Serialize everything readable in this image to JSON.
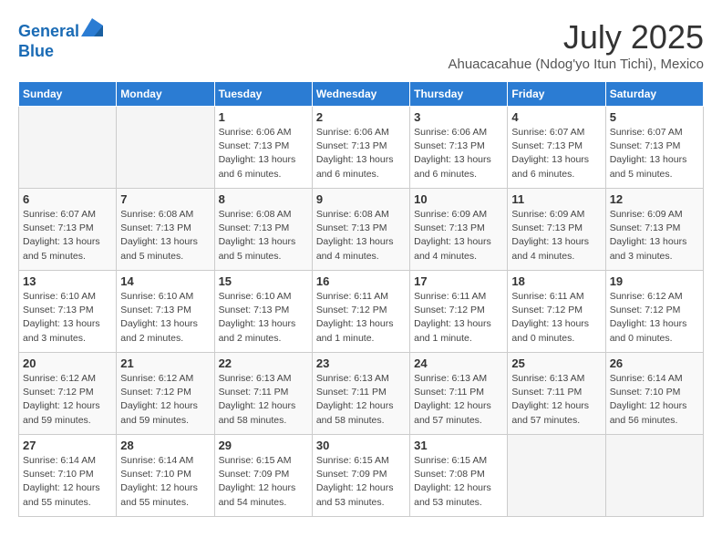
{
  "header": {
    "logo_line1": "General",
    "logo_line2": "Blue",
    "month": "July 2025",
    "location": "Ahuacacahue (Ndog'yo Itun Tichi), Mexico"
  },
  "weekdays": [
    "Sunday",
    "Monday",
    "Tuesday",
    "Wednesday",
    "Thursday",
    "Friday",
    "Saturday"
  ],
  "weeks": [
    [
      {
        "day": "",
        "empty": true
      },
      {
        "day": "",
        "empty": true
      },
      {
        "day": "1",
        "sunrise": "Sunrise: 6:06 AM",
        "sunset": "Sunset: 7:13 PM",
        "daylight": "Daylight: 13 hours and 6 minutes."
      },
      {
        "day": "2",
        "sunrise": "Sunrise: 6:06 AM",
        "sunset": "Sunset: 7:13 PM",
        "daylight": "Daylight: 13 hours and 6 minutes."
      },
      {
        "day": "3",
        "sunrise": "Sunrise: 6:06 AM",
        "sunset": "Sunset: 7:13 PM",
        "daylight": "Daylight: 13 hours and 6 minutes."
      },
      {
        "day": "4",
        "sunrise": "Sunrise: 6:07 AM",
        "sunset": "Sunset: 7:13 PM",
        "daylight": "Daylight: 13 hours and 6 minutes."
      },
      {
        "day": "5",
        "sunrise": "Sunrise: 6:07 AM",
        "sunset": "Sunset: 7:13 PM",
        "daylight": "Daylight: 13 hours and 5 minutes."
      }
    ],
    [
      {
        "day": "6",
        "sunrise": "Sunrise: 6:07 AM",
        "sunset": "Sunset: 7:13 PM",
        "daylight": "Daylight: 13 hours and 5 minutes."
      },
      {
        "day": "7",
        "sunrise": "Sunrise: 6:08 AM",
        "sunset": "Sunset: 7:13 PM",
        "daylight": "Daylight: 13 hours and 5 minutes."
      },
      {
        "day": "8",
        "sunrise": "Sunrise: 6:08 AM",
        "sunset": "Sunset: 7:13 PM",
        "daylight": "Daylight: 13 hours and 5 minutes."
      },
      {
        "day": "9",
        "sunrise": "Sunrise: 6:08 AM",
        "sunset": "Sunset: 7:13 PM",
        "daylight": "Daylight: 13 hours and 4 minutes."
      },
      {
        "day": "10",
        "sunrise": "Sunrise: 6:09 AM",
        "sunset": "Sunset: 7:13 PM",
        "daylight": "Daylight: 13 hours and 4 minutes."
      },
      {
        "day": "11",
        "sunrise": "Sunrise: 6:09 AM",
        "sunset": "Sunset: 7:13 PM",
        "daylight": "Daylight: 13 hours and 4 minutes."
      },
      {
        "day": "12",
        "sunrise": "Sunrise: 6:09 AM",
        "sunset": "Sunset: 7:13 PM",
        "daylight": "Daylight: 13 hours and 3 minutes."
      }
    ],
    [
      {
        "day": "13",
        "sunrise": "Sunrise: 6:10 AM",
        "sunset": "Sunset: 7:13 PM",
        "daylight": "Daylight: 13 hours and 3 minutes."
      },
      {
        "day": "14",
        "sunrise": "Sunrise: 6:10 AM",
        "sunset": "Sunset: 7:13 PM",
        "daylight": "Daylight: 13 hours and 2 minutes."
      },
      {
        "day": "15",
        "sunrise": "Sunrise: 6:10 AM",
        "sunset": "Sunset: 7:13 PM",
        "daylight": "Daylight: 13 hours and 2 minutes."
      },
      {
        "day": "16",
        "sunrise": "Sunrise: 6:11 AM",
        "sunset": "Sunset: 7:12 PM",
        "daylight": "Daylight: 13 hours and 1 minute."
      },
      {
        "day": "17",
        "sunrise": "Sunrise: 6:11 AM",
        "sunset": "Sunset: 7:12 PM",
        "daylight": "Daylight: 13 hours and 1 minute."
      },
      {
        "day": "18",
        "sunrise": "Sunrise: 6:11 AM",
        "sunset": "Sunset: 7:12 PM",
        "daylight": "Daylight: 13 hours and 0 minutes."
      },
      {
        "day": "19",
        "sunrise": "Sunrise: 6:12 AM",
        "sunset": "Sunset: 7:12 PM",
        "daylight": "Daylight: 13 hours and 0 minutes."
      }
    ],
    [
      {
        "day": "20",
        "sunrise": "Sunrise: 6:12 AM",
        "sunset": "Sunset: 7:12 PM",
        "daylight": "Daylight: 12 hours and 59 minutes."
      },
      {
        "day": "21",
        "sunrise": "Sunrise: 6:12 AM",
        "sunset": "Sunset: 7:12 PM",
        "daylight": "Daylight: 12 hours and 59 minutes."
      },
      {
        "day": "22",
        "sunrise": "Sunrise: 6:13 AM",
        "sunset": "Sunset: 7:11 PM",
        "daylight": "Daylight: 12 hours and 58 minutes."
      },
      {
        "day": "23",
        "sunrise": "Sunrise: 6:13 AM",
        "sunset": "Sunset: 7:11 PM",
        "daylight": "Daylight: 12 hours and 58 minutes."
      },
      {
        "day": "24",
        "sunrise": "Sunrise: 6:13 AM",
        "sunset": "Sunset: 7:11 PM",
        "daylight": "Daylight: 12 hours and 57 minutes."
      },
      {
        "day": "25",
        "sunrise": "Sunrise: 6:13 AM",
        "sunset": "Sunset: 7:11 PM",
        "daylight": "Daylight: 12 hours and 57 minutes."
      },
      {
        "day": "26",
        "sunrise": "Sunrise: 6:14 AM",
        "sunset": "Sunset: 7:10 PM",
        "daylight": "Daylight: 12 hours and 56 minutes."
      }
    ],
    [
      {
        "day": "27",
        "sunrise": "Sunrise: 6:14 AM",
        "sunset": "Sunset: 7:10 PM",
        "daylight": "Daylight: 12 hours and 55 minutes."
      },
      {
        "day": "28",
        "sunrise": "Sunrise: 6:14 AM",
        "sunset": "Sunset: 7:10 PM",
        "daylight": "Daylight: 12 hours and 55 minutes."
      },
      {
        "day": "29",
        "sunrise": "Sunrise: 6:15 AM",
        "sunset": "Sunset: 7:09 PM",
        "daylight": "Daylight: 12 hours and 54 minutes."
      },
      {
        "day": "30",
        "sunrise": "Sunrise: 6:15 AM",
        "sunset": "Sunset: 7:09 PM",
        "daylight": "Daylight: 12 hours and 53 minutes."
      },
      {
        "day": "31",
        "sunrise": "Sunrise: 6:15 AM",
        "sunset": "Sunset: 7:08 PM",
        "daylight": "Daylight: 12 hours and 53 minutes."
      },
      {
        "day": "",
        "empty": true
      },
      {
        "day": "",
        "empty": true
      }
    ]
  ]
}
